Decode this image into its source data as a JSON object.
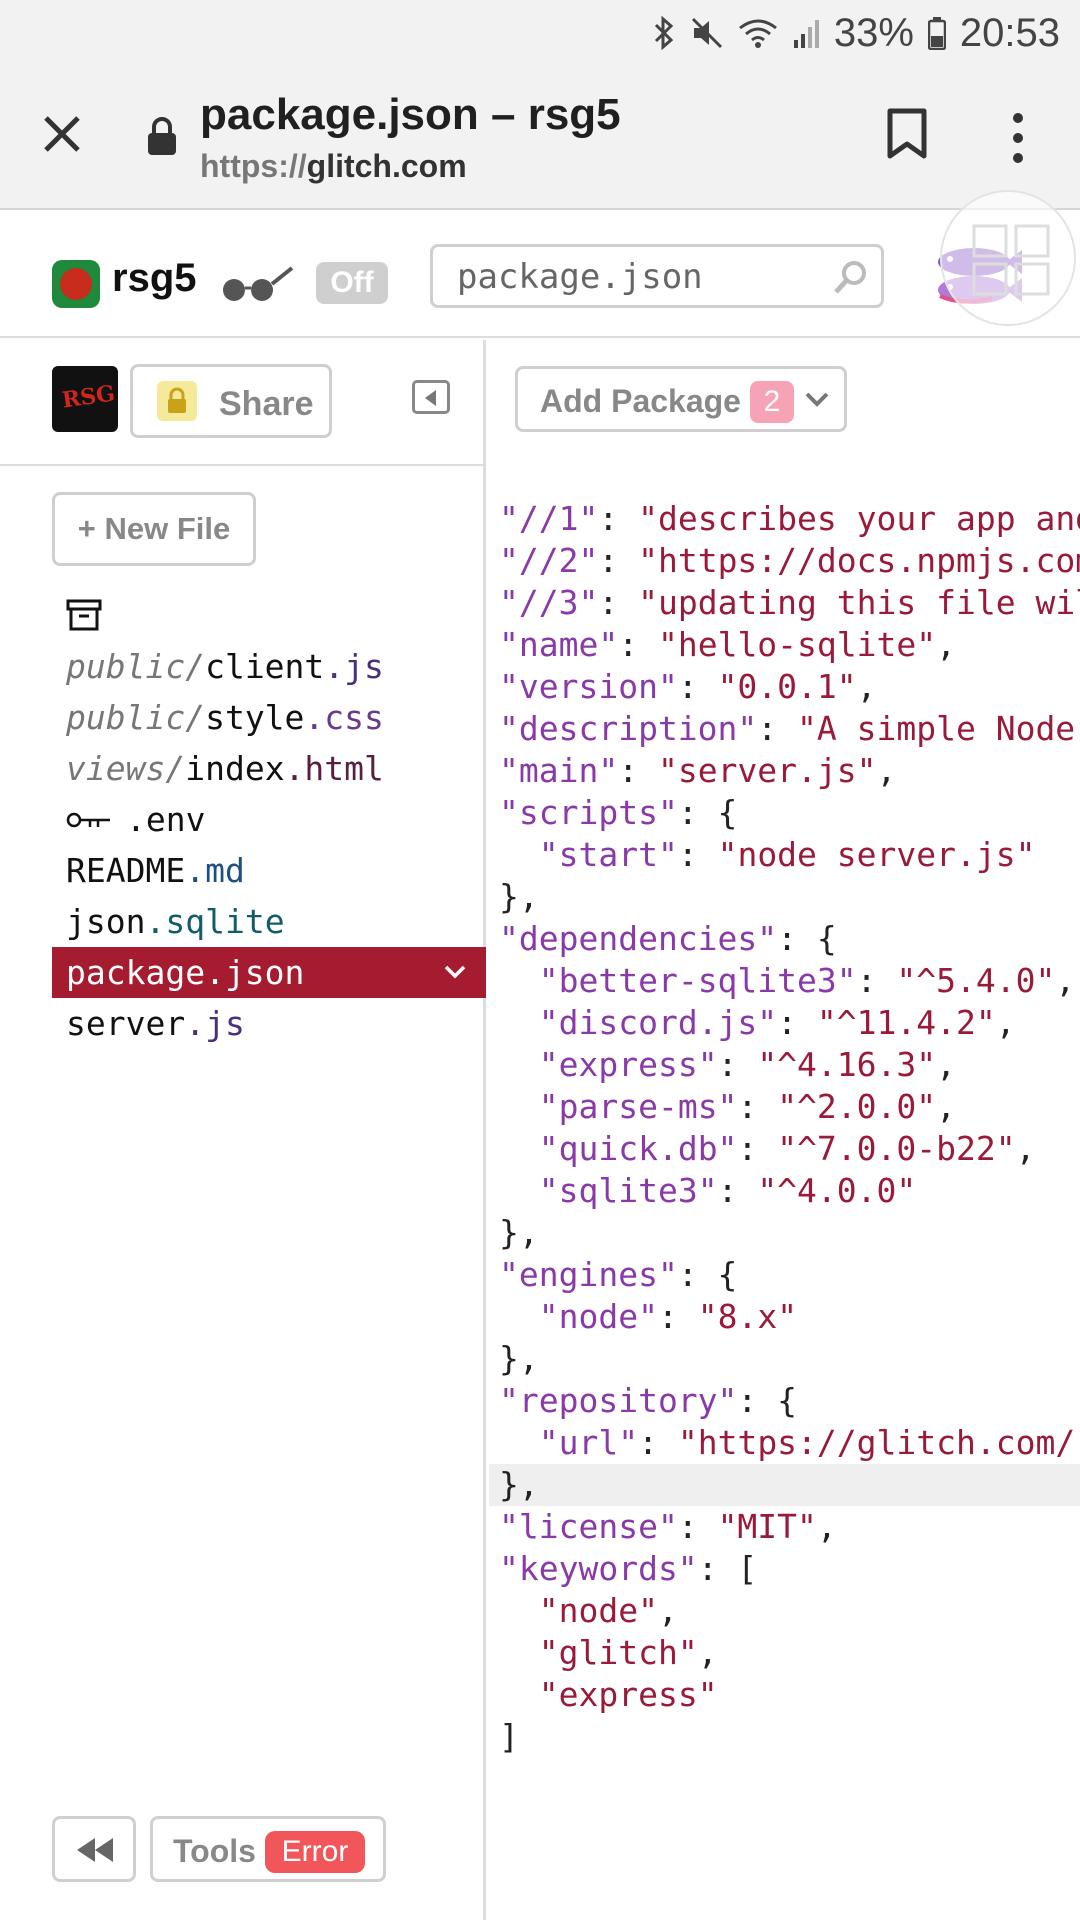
{
  "status_bar": {
    "battery": "33%",
    "time": "20:53"
  },
  "browser": {
    "title": "package.json – rsg5",
    "url_scheme": "https://",
    "url_host": "glitch.com"
  },
  "header": {
    "project_name": "rsg5",
    "toggle_label": "Off",
    "search_placeholder": "package.json"
  },
  "sidebar": {
    "team_mark": "RSG",
    "share_label": "Share",
    "new_file_label": "+ New File",
    "files": [
      {
        "name": "assets",
        "icon": "archive-icon"
      },
      {
        "dir": "public/",
        "base": "client",
        "ext": ".js"
      },
      {
        "dir": "public/",
        "base": "style",
        "ext": ".css"
      },
      {
        "dir": "views/",
        "base": "index",
        "ext": ".html"
      },
      {
        "base": ".env",
        "icon": "key-icon"
      },
      {
        "base": "README",
        "ext": ".md"
      },
      {
        "base": "json",
        "ext": ".sqlite"
      },
      {
        "base": "package.json",
        "selected": true
      },
      {
        "base": "server",
        "ext": ".js"
      }
    ],
    "tools_label": "Tools",
    "error_label": "Error"
  },
  "editor": {
    "add_package_label": "Add Package",
    "package_count": "2",
    "lines": [
      [
        [
          "k",
          "\"//1\""
        ],
        [
          "p",
          ": "
        ],
        [
          "s",
          "\"describes your app and its dependencies\""
        ]
      ],
      [
        [
          "k",
          "\"//2\""
        ],
        [
          "p",
          ": "
        ],
        [
          "s",
          "\"https://docs.npmjs.com/files/package.json\""
        ]
      ],
      [
        [
          "k",
          "\"//3\""
        ],
        [
          "p",
          ": "
        ],
        [
          "s",
          "\"updating this file will download and update your packages\""
        ]
      ],
      [
        [
          "k",
          "\"name\""
        ],
        [
          "p",
          ": "
        ],
        [
          "s",
          "\"hello-sqlite\""
        ],
        [
          "p",
          ","
        ]
      ],
      [
        [
          "k",
          "\"version\""
        ],
        [
          "p",
          ": "
        ],
        [
          "s",
          "\"0.0.1\""
        ],
        [
          "p",
          ","
        ]
      ],
      [
        [
          "k",
          "\"description\""
        ],
        [
          "p",
          ": "
        ],
        [
          "s",
          "\"A simple Node app\""
        ]
      ],
      [
        [
          "k",
          "\"main\""
        ],
        [
          "p",
          ": "
        ],
        [
          "s",
          "\"server.js\""
        ],
        [
          "p",
          ","
        ]
      ],
      [
        [
          "k",
          "\"scripts\""
        ],
        [
          "p",
          ": {"
        ]
      ],
      [
        [
          "p",
          "  "
        ],
        [
          "k",
          "\"start\""
        ],
        [
          "p",
          ": "
        ],
        [
          "s",
          "\"node server.js\""
        ]
      ],
      [
        [
          "p",
          "},"
        ]
      ],
      [
        [
          "k",
          "\"dependencies\""
        ],
        [
          "p",
          ": {"
        ]
      ],
      [
        [
          "p",
          "  "
        ],
        [
          "k",
          "\"better-sqlite3\""
        ],
        [
          "p",
          ": "
        ],
        [
          "s",
          "\"^5.4.0\""
        ],
        [
          "p",
          ","
        ]
      ],
      [
        [
          "p",
          "  "
        ],
        [
          "k",
          "\"discord.js\""
        ],
        [
          "p",
          ": "
        ],
        [
          "s",
          "\"^11.4.2\""
        ],
        [
          "p",
          ","
        ]
      ],
      [
        [
          "p",
          "  "
        ],
        [
          "k",
          "\"express\""
        ],
        [
          "p",
          ": "
        ],
        [
          "s",
          "\"^4.16.3\""
        ],
        [
          "p",
          ","
        ]
      ],
      [
        [
          "p",
          "  "
        ],
        [
          "k",
          "\"parse-ms\""
        ],
        [
          "p",
          ": "
        ],
        [
          "s",
          "\"^2.0.0\""
        ],
        [
          "p",
          ","
        ]
      ],
      [
        [
          "p",
          "  "
        ],
        [
          "k",
          "\"quick.db\""
        ],
        [
          "p",
          ": "
        ],
        [
          "s",
          "\"^7.0.0-b22\""
        ],
        [
          "p",
          ","
        ]
      ],
      [
        [
          "p",
          "  "
        ],
        [
          "k",
          "\"sqlite3\""
        ],
        [
          "p",
          ": "
        ],
        [
          "s",
          "\"^4.0.0\""
        ]
      ],
      [
        [
          "p",
          "},"
        ]
      ],
      [
        [
          "k",
          "\"engines\""
        ],
        [
          "p",
          ": {"
        ]
      ],
      [
        [
          "p",
          "  "
        ],
        [
          "k",
          "\"node\""
        ],
        [
          "p",
          ": "
        ],
        [
          "s",
          "\"8.x\""
        ]
      ],
      [
        [
          "p",
          "},"
        ]
      ],
      [
        [
          "k",
          "\"repository\""
        ],
        [
          "p",
          ": {"
        ]
      ],
      [
        [
          "p",
          "  "
        ],
        [
          "k",
          "\"url\""
        ],
        [
          "p",
          ": "
        ],
        [
          "s",
          "\"https://glitch.com/\""
        ]
      ],
      [
        [
          "p",
          "},"
        ]
      ],
      [
        [
          "k",
          "\"license\""
        ],
        [
          "p",
          ": "
        ],
        [
          "s",
          "\"MIT\""
        ],
        [
          "p",
          ","
        ]
      ],
      [
        [
          "k",
          "\"keywords\""
        ],
        [
          "p",
          ": ["
        ]
      ],
      [
        [
          "p",
          "  "
        ],
        [
          "s",
          "\"node\""
        ],
        [
          "p",
          ","
        ]
      ],
      [
        [
          "p",
          "  "
        ],
        [
          "s",
          "\"glitch\""
        ],
        [
          "p",
          ","
        ]
      ],
      [
        [
          "p",
          "  "
        ],
        [
          "s",
          "\"express\""
        ]
      ],
      [
        [
          "p",
          "]"
        ]
      ]
    ],
    "highlighted_line": 23
  }
}
